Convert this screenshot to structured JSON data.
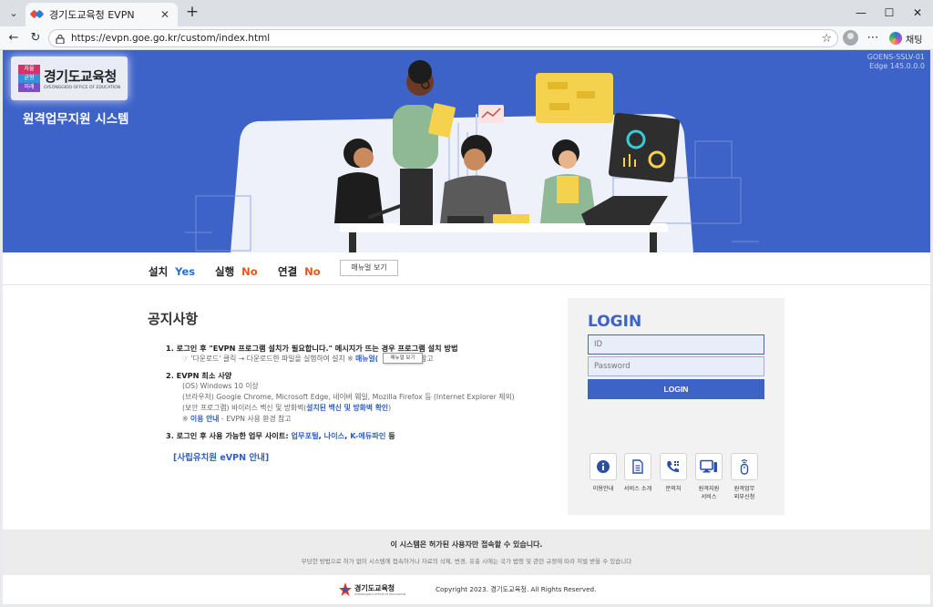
{
  "browser": {
    "tab_title": "경기도교육청 EVPN",
    "url": "https://evpn.goe.go.kr/custom/index.html",
    "copilot_label": "채팅"
  },
  "header": {
    "logo_name": "경기도교육청",
    "logo_sub": "GYEONGGIDO OFFICE OF EDUCATION",
    "logo_mark_lines": [
      "자율",
      "균형",
      "미래"
    ],
    "system_title": "원격업무지원 시스템",
    "version_line1": "GOENS-SSLV-01",
    "version_line2": "Edge 145.0.0.0"
  },
  "status": {
    "install_label": "설치",
    "install_value": "Yes",
    "run_label": "실행",
    "run_value": "No",
    "connect_label": "연결",
    "connect_value": "No",
    "manual_button": "매뉴얼 보기"
  },
  "notice": {
    "title": "공지사항",
    "item1": "1. 로그인 후 \"EVPN 프로그램 설치가 필요합니다.\" 메시지가 뜨는 경우 프로그램 설치 방법",
    "item1_sub_a": "☞ '다운로드' 클릭 → 다운로드한 파일을 실행하여 설치   ※ ",
    "item1_sub_link": "매뉴얼(",
    "item1_sub_b": "참고",
    "tooltip": "매뉴얼 보기",
    "item2": "2. EVPN 최소 사양",
    "item2_sub1": "(OS) Windows 10 이상",
    "item2_sub2": "(브라우저) Google Chrome, Microsoft Edge, 네이버 웨일, Mozilla Firefox 등 (Internet Explorer 제외)",
    "item2_sub3_a": "(보안 프로그램) 바이러스 백신 및 방화벽(",
    "item2_sub3_link": "설치된 백신 및 방화벽 확인",
    "item2_sub3_b": ")",
    "item2_sub4_a": "※ ",
    "item2_sub4_link": "이용 안내",
    "item2_sub4_b": " - EVPN 사용 환경 참고",
    "item3_a": "3. 로그인 후 사용 가능한 업무 사이트: ",
    "item3_link1": "업무포털",
    "item3_sep1": ", ",
    "item3_link2": "나이스",
    "item3_sep2": ", ",
    "item3_link3": "K-에듀파인",
    "item3_b": " 등",
    "private_link": "[사립유치원 eVPN 안내]"
  },
  "login": {
    "title": "LOGIN",
    "id_placeholder": "ID",
    "pw_placeholder": "Password",
    "button": "LOGIN"
  },
  "quick_links": [
    {
      "label": "이용안내",
      "icon": "info-icon"
    },
    {
      "label": "서비스 소개",
      "icon": "document-icon"
    },
    {
      "label": "문의처",
      "icon": "phone-icon"
    },
    {
      "label": "원격지원 서비스",
      "icon": "monitor-icon"
    },
    {
      "label": "원격업무 외부신청",
      "icon": "remote-device-icon"
    }
  ],
  "footer": {
    "notice_main": "이 시스템은 허가된 사용자만 접속할 수 있습니다.",
    "notice_sub": "부당한 방법으로 허가 없이 시스템에 접속하거나 자료의 삭제, 변경, 유출 시에는 국가 법령 및 관련 규정에 따라 처벌 받을 수 있습니다",
    "logo_name": "경기도교육청",
    "copyright": "Copyright 2023. 경기도교육청. All Rights Reserved."
  },
  "colors": {
    "brand_blue": "#3d62c8",
    "yes": "#2d6fd0",
    "no": "#e05a1e"
  }
}
